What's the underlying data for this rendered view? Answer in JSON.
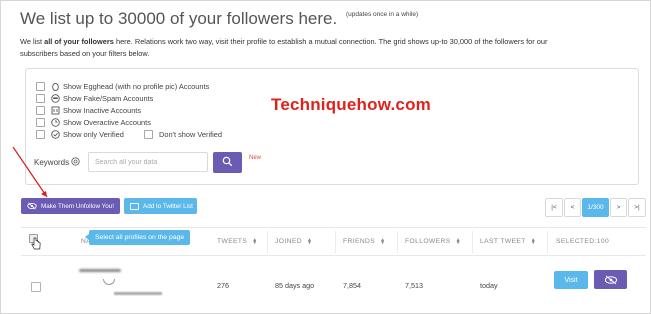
{
  "header": {
    "title": "We list up to 30000 of your followers here.",
    "note": "(updates once in a while)"
  },
  "intro": {
    "prefix": "We list ",
    "bold": "all of your followers",
    "rest": " here. Relations work two way, visit their profile to establish a mutual connection. The grid shows up-to 30,000 of the followers for our subscribers based on your filters below."
  },
  "filters": {
    "options": [
      {
        "label": "Show Egghead (with no profile pic) Accounts",
        "icon": "egg-icon"
      },
      {
        "label": "Show Fake/Spam Accounts",
        "icon": "fake-account-icon"
      },
      {
        "label": "Show Inactive Accounts",
        "icon": "inactive-icon"
      },
      {
        "label": "Show Overactive Accounts",
        "icon": "overactive-icon"
      },
      {
        "label": "Show only Verified",
        "icon": "verified-icon"
      }
    ],
    "dont_show_verified": "Don't show Verified",
    "keywords_label": "Keywords",
    "search_placeholder": "Search all your data",
    "new_badge": "New"
  },
  "watermark": "Techniquehow.com",
  "actions": {
    "unfollow_label": "Make Them Unfollow You!",
    "twitter_list_label": "Add to Twitter List"
  },
  "pagination": {
    "first": "|<",
    "prev": "<",
    "current": "1/300",
    "next": ">",
    "last": ">|"
  },
  "table": {
    "tooltip": "Select all profiles on the page",
    "headers": {
      "name": "NA",
      "tweets": "TWEETS",
      "joined": "JOINED",
      "friends": "FRIENDS",
      "followers": "FOLLOWERS",
      "last_tweet": "LAST TWEET",
      "selected": "SELECTED:100"
    },
    "rows": [
      {
        "tweets": "276",
        "joined": "85 days ago",
        "friends": "7,854",
        "followers": "7,513",
        "last_tweet": "today",
        "visit_label": "Visit"
      }
    ]
  },
  "colors": {
    "purple": "#6b5bb2",
    "blue": "#5bb8ea",
    "watermark_red": "#e0221c"
  }
}
